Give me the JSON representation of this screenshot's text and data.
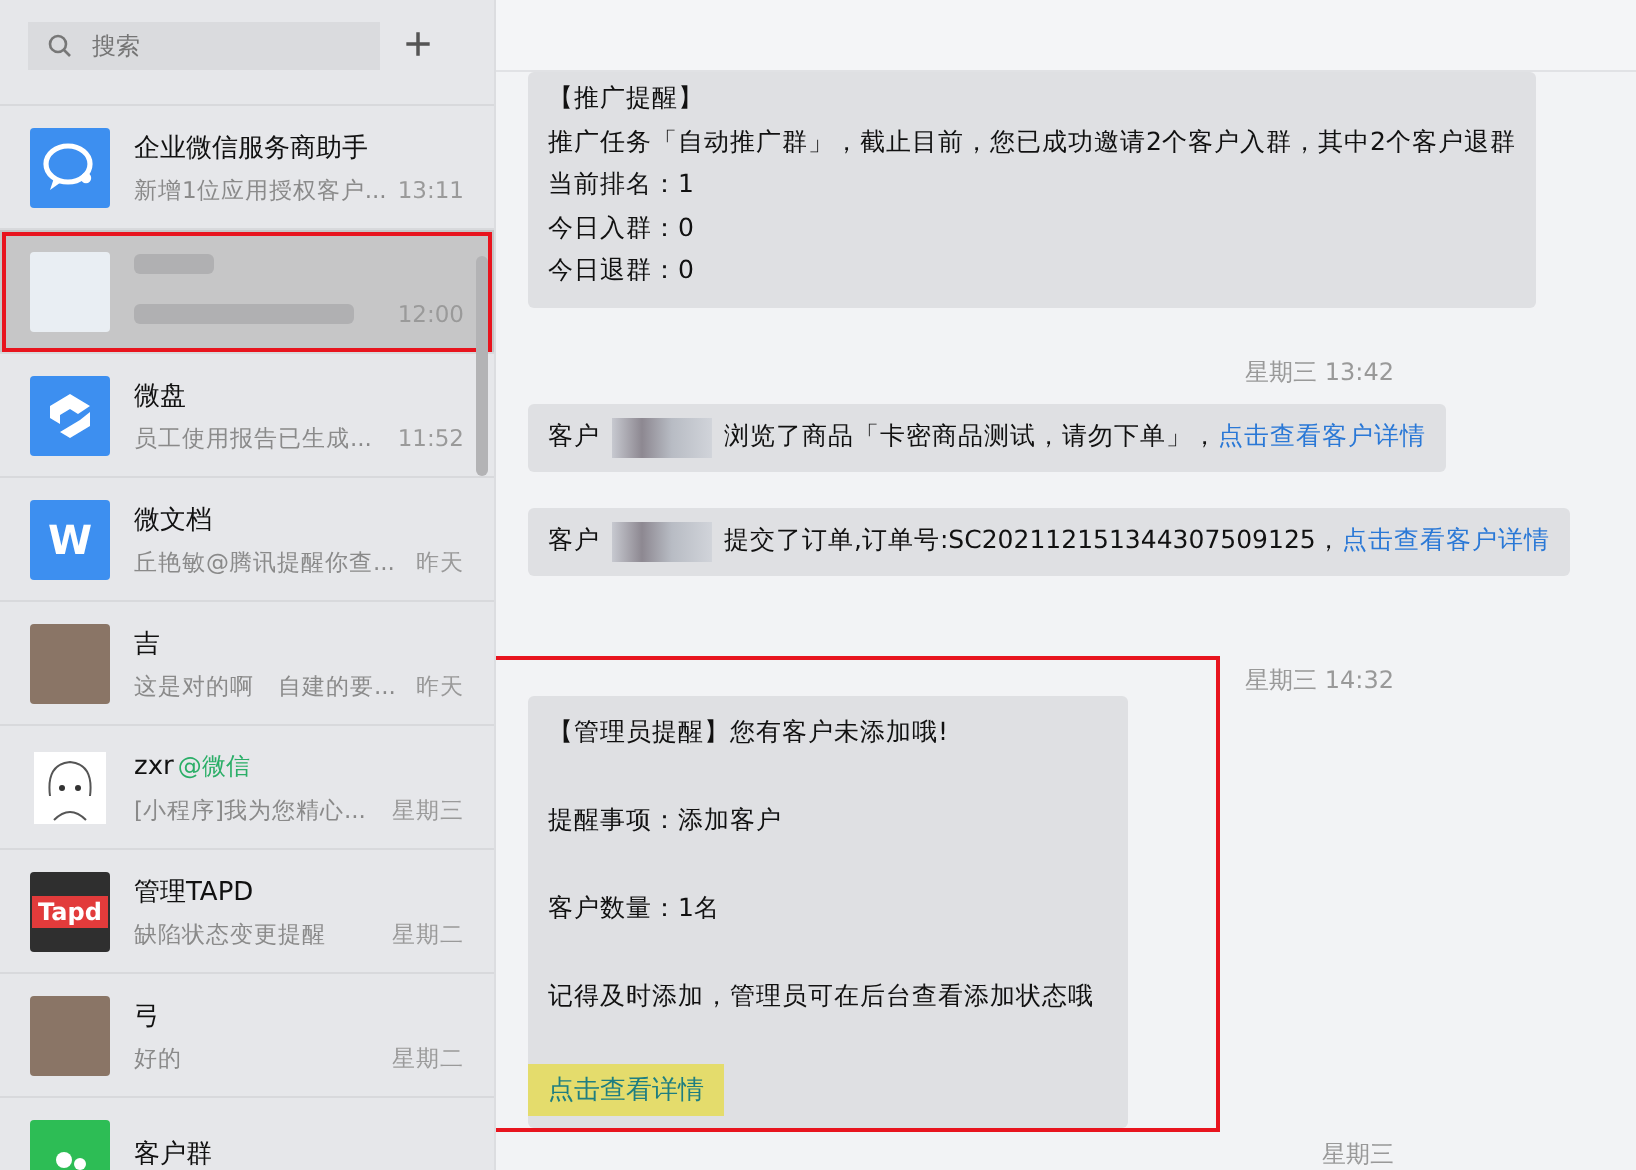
{
  "sidebar": {
    "search": {
      "placeholder": "搜索"
    },
    "add_button": "+",
    "conversations": [
      {
        "kind": "chat-bubble",
        "name": "企业微信服务商助手",
        "preview": "新增1位应用授权客户...",
        "time": "13:11",
        "selected": false,
        "outlined": false
      },
      {
        "kind": "photo",
        "time": "12:00",
        "selected": true,
        "outlined": true
      },
      {
        "kind": "drive",
        "name": "微盘",
        "preview": "员工使用报告已生成...",
        "time": "11:52",
        "selected": false,
        "outlined": false
      },
      {
        "kind": "doc",
        "logo": "W",
        "name": "微文档",
        "preview": "丘艳敏@腾讯提醒你查...",
        "time": "昨天",
        "selected": false,
        "outlined": false
      },
      {
        "kind": "person",
        "name": "吉",
        "preview": "这是对的啊　自建的要...",
        "time": "昨天",
        "selected": false,
        "outlined": false
      },
      {
        "kind": "sketch",
        "name": "zxr",
        "tag": "@微信",
        "preview": "[小程序]我为您精心...",
        "time": "星期三",
        "selected": false,
        "outlined": false
      },
      {
        "kind": "tapd",
        "logo": "Tapd",
        "name": "管理TAPD",
        "preview": "缺陷状态变更提醒",
        "time": "星期二",
        "selected": false,
        "outlined": false
      },
      {
        "kind": "person",
        "name": "弓",
        "preview": "好的",
        "time": "星期二",
        "selected": false,
        "outlined": false
      },
      {
        "kind": "group",
        "name": "客户群",
        "selected": false,
        "outlined": false
      }
    ]
  },
  "messages": [
    {
      "kind": "notice",
      "lines": [
        "【推广提醒】",
        "推广任务「自动推广群」，截止目前，您已成功邀请2个客户入群，其中2个客户退群",
        "当前排名：1",
        "今日入群：0",
        "今日退群：0"
      ]
    },
    {
      "kind": "time",
      "text": "星期三 13:42"
    },
    {
      "kind": "customer",
      "prefix": "客户",
      "text": "浏览了商品「卡密商品测试，请勿下单」，",
      "link": "点击查看客户详情"
    },
    {
      "kind": "customer",
      "prefix": "客户",
      "text": "提交了订单,订单号:SC202112151344307509125，",
      "link": "点击查看客户详情"
    },
    {
      "kind": "time",
      "text": "星期三 14:32"
    },
    {
      "kind": "card",
      "outlined": true,
      "lines": [
        "【管理员提醒】您有客户未添加哦!",
        "提醒事项：添加客户",
        "客户数量：1名",
        "记得及时添加，管理员可在后台查看添加状态哦"
      ],
      "link": "点击查看详情",
      "link_highlighted": true
    },
    {
      "kind": "time",
      "text": "星期三"
    }
  ]
}
